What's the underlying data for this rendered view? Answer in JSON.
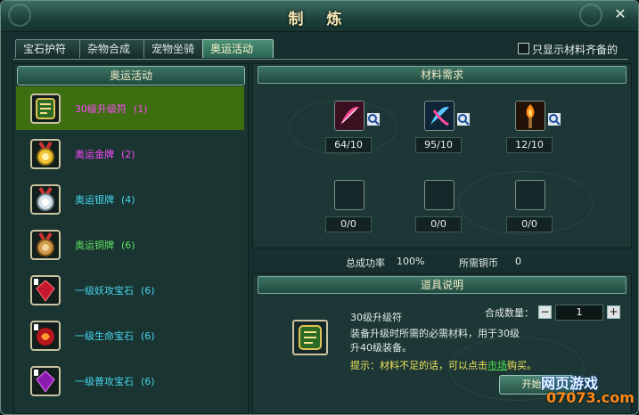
{
  "window": {
    "title": "制 炼",
    "close": "✕"
  },
  "tabs": [
    {
      "label": "宝石护符"
    },
    {
      "label": "杂物合成"
    },
    {
      "label": "宠物坐骑"
    },
    {
      "label": "奥运活动",
      "active": true
    }
  ],
  "filter": {
    "label": "只显示材料齐备的"
  },
  "list": {
    "header": "奥运活动",
    "items": [
      {
        "name": "30级升级符",
        "count": "(1)",
        "color": "#ff48ff",
        "icon": "upgrade-scroll-icon",
        "selected": true
      },
      {
        "name": "奥运金牌",
        "count": "(2)",
        "color": "#ff48ff",
        "icon": "gold-medal-icon"
      },
      {
        "name": "奥运银牌",
        "count": "(4)",
        "color": "#46d7ee",
        "icon": "silver-medal-icon"
      },
      {
        "name": "奥运铜牌",
        "count": "(6)",
        "color": "#5fe25f",
        "icon": "bronze-medal-icon"
      },
      {
        "name": "一级妖攻宝石",
        "count": "(6)",
        "color": "#46d7ee",
        "icon": "red-gem-icon"
      },
      {
        "name": "一级生命宝石",
        "count": "(6)",
        "color": "#46d7ee",
        "icon": "life-gem-icon"
      },
      {
        "name": "一级普攻宝石",
        "count": "(6)",
        "color": "#46d7ee",
        "icon": "purple-gem-icon"
      }
    ]
  },
  "materials": {
    "header": "材料需求",
    "slots": [
      {
        "count": "64/10",
        "icon": "pink-feather-icon"
      },
      {
        "count": "95/10",
        "icon": "blue-feather-icon"
      },
      {
        "count": "12/10",
        "icon": "torch-icon"
      },
      {
        "count": "0/0",
        "icon": "empty-slot"
      },
      {
        "count": "0/0",
        "icon": "empty-slot"
      },
      {
        "count": "0/0",
        "icon": "empty-slot"
      }
    ],
    "success_label": "总成功率",
    "success_value": "100%",
    "coin_label": "所需铜币",
    "coin_value": "0"
  },
  "item_info": {
    "header": "道具说明",
    "name": "30级升级符",
    "desc1": "装备升级时所需的必需材料，用于30级",
    "desc2": "升40级装备。",
    "hint_prefix": "提示：材料不足的话，可以点击",
    "hint_link": "市场",
    "hint_suffix": "购买。",
    "qty_label": "合成数量：",
    "qty_value": "1",
    "minus": "−",
    "plus": "+",
    "start_button": "开始制",
    "icon": "upgrade-scroll-icon"
  },
  "watermark": {
    "line1": "网页游戏",
    "line2": "07073.com"
  }
}
